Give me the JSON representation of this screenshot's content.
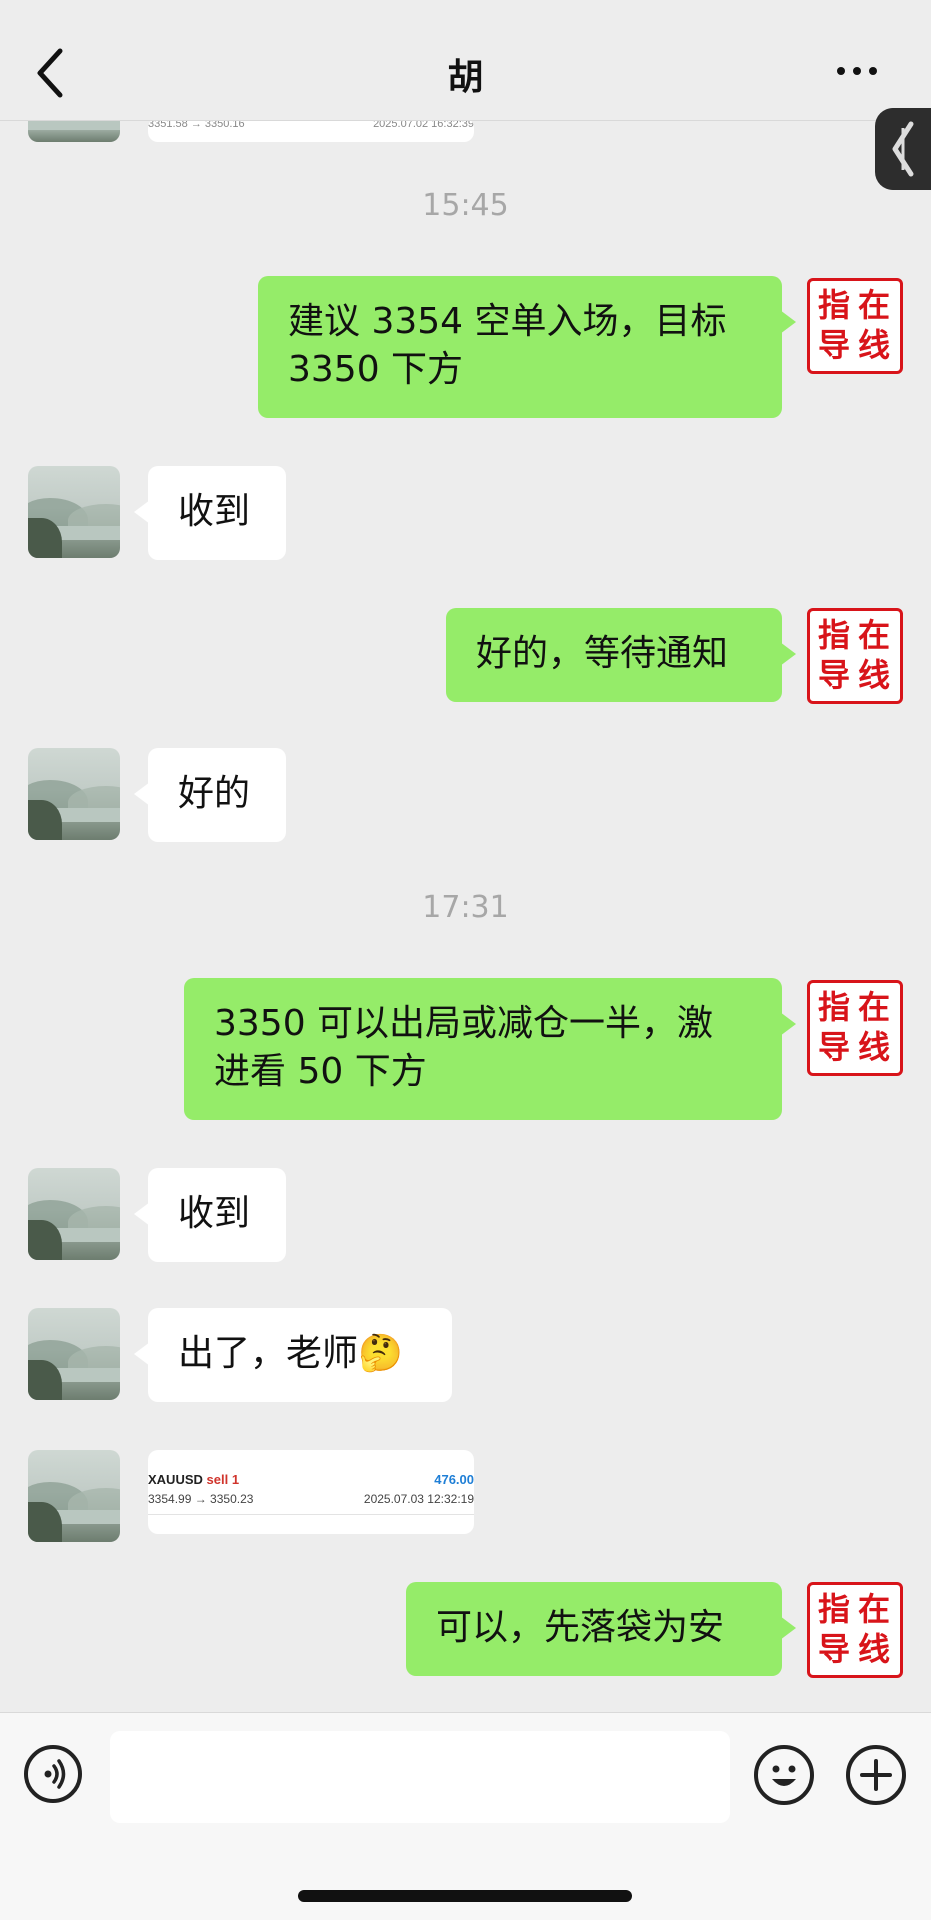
{
  "header": {
    "title": "胡",
    "back_icon": "chevron-left-icon",
    "more_icon": "more-dots-icon"
  },
  "stamp": {
    "chars": [
      "指",
      "在",
      "导",
      "线"
    ],
    "color": "#d8141a"
  },
  "times": [
    "15:45",
    "17:31"
  ],
  "top_card_partial": {
    "price": "3351.58 → 3350.16",
    "date": "2025.07.02 16:32:39"
  },
  "messages": [
    {
      "from": "me",
      "text": "建议 3354 空单入场，目标\n3350 下方"
    },
    {
      "from": "them",
      "text": "收到"
    },
    {
      "from": "me",
      "text": "好的，等待通知"
    },
    {
      "from": "them",
      "text": "好的"
    },
    {
      "from": "me",
      "text": "3350 可以出局或减仓一半，激\n进看 50 下方"
    },
    {
      "from": "them",
      "text": "收到"
    },
    {
      "from": "them",
      "text": "出了，老师🤔"
    },
    {
      "from": "me",
      "text": "可以，先落袋为安"
    }
  ],
  "trade_card": {
    "symbol": "XAUUSD",
    "side": "sell 1",
    "profit": "476.00",
    "price": "3354.99 → 3350.23",
    "date": "2025.07.03 12:32:19"
  },
  "input": {
    "placeholder": ""
  },
  "colors": {
    "bubble_me": "#95ec69",
    "bubble_them": "#ffffff",
    "background": "#ededed"
  }
}
